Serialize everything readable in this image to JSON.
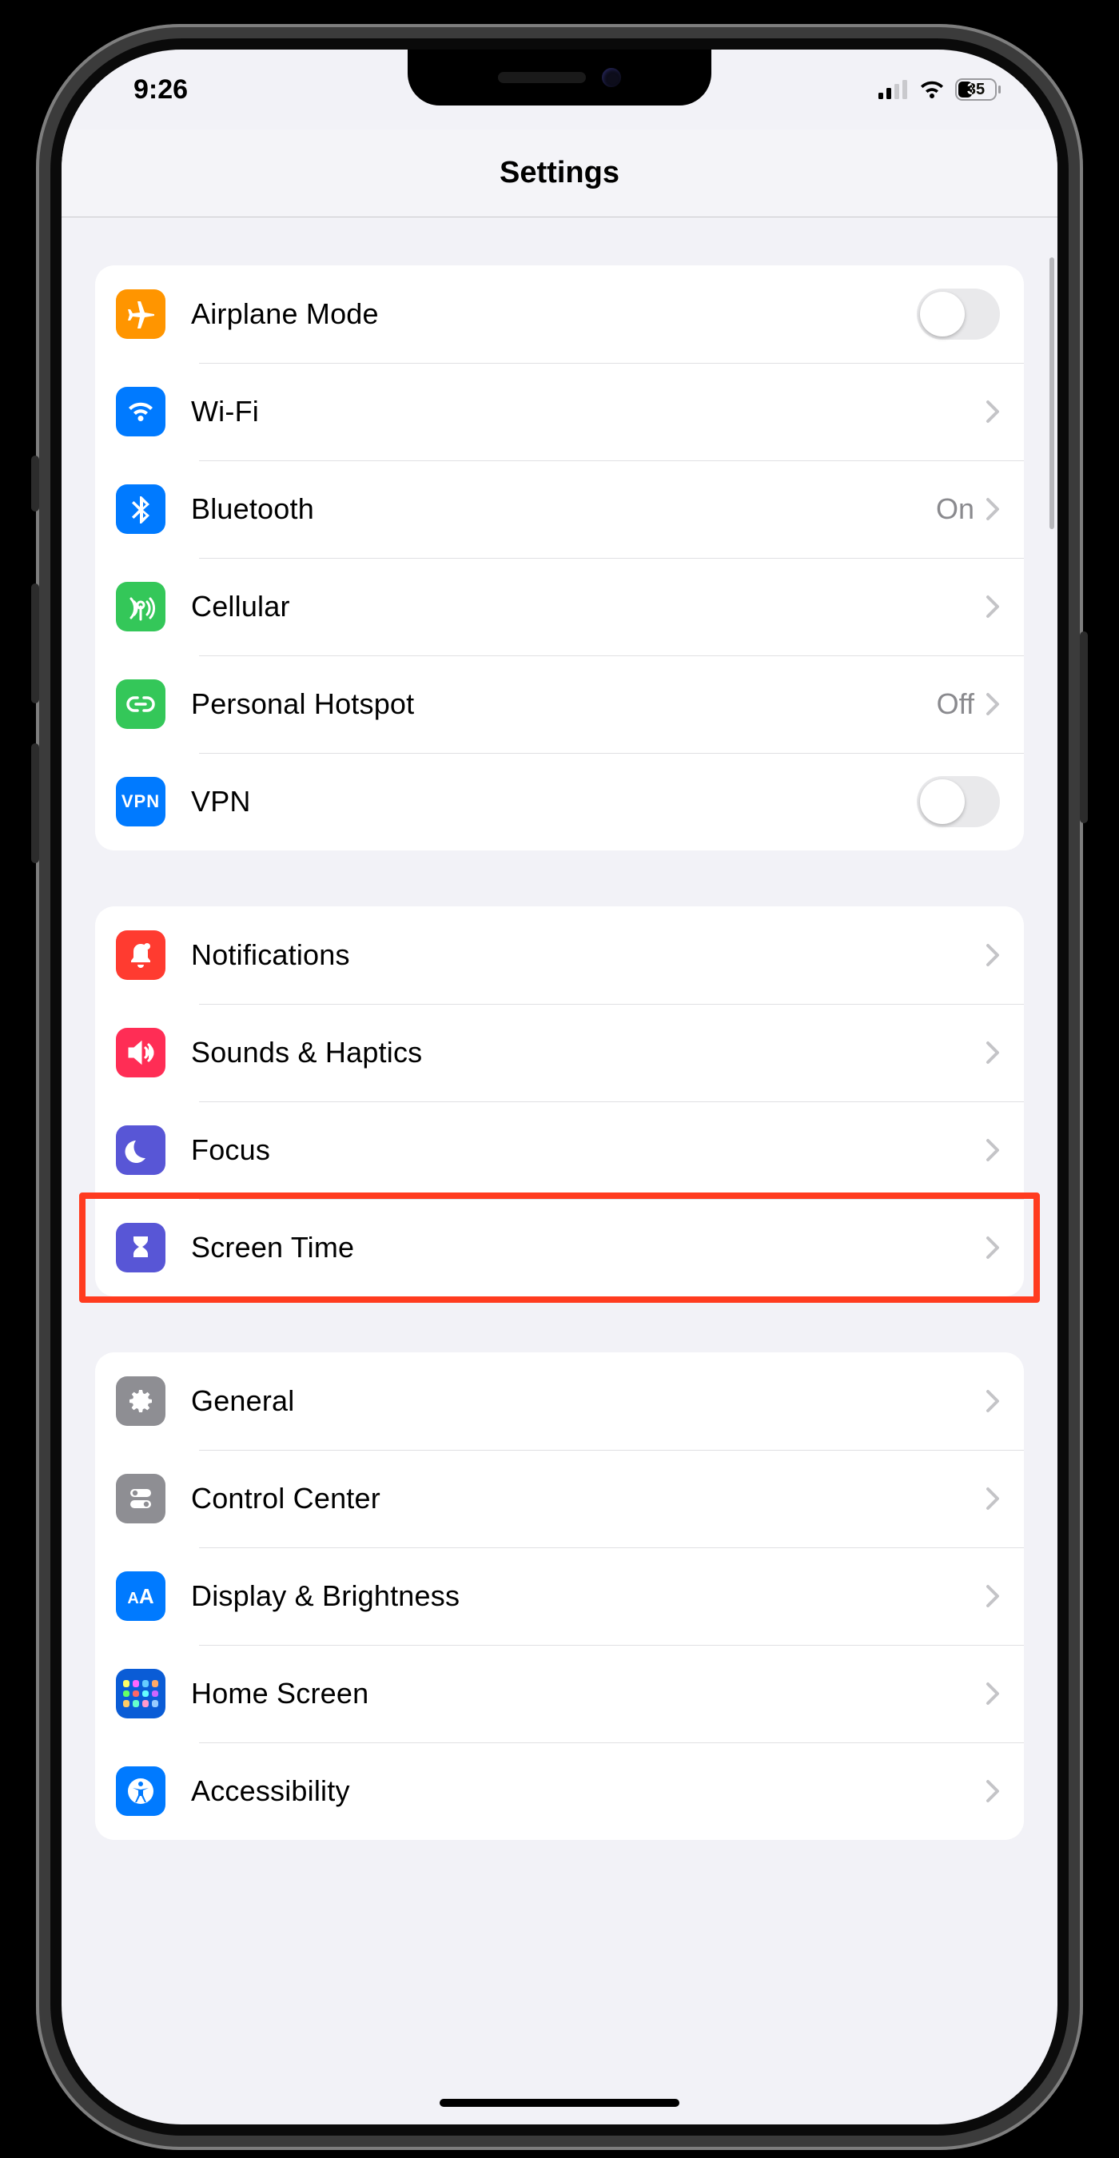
{
  "status": {
    "time": "9:26",
    "battery": "35"
  },
  "nav": {
    "title": "Settings"
  },
  "sections": [
    {
      "rows": [
        {
          "key": "airplane",
          "icon": "airplane-icon",
          "color": "c-orange",
          "label": "Airplane Mode",
          "control": "toggle",
          "toggled": false
        },
        {
          "key": "wifi",
          "icon": "wifi-icon",
          "color": "c-blue",
          "label": "Wi-Fi",
          "value": "",
          "chevron": true
        },
        {
          "key": "bluetooth",
          "icon": "bluetooth-icon",
          "color": "c-blue",
          "label": "Bluetooth",
          "value": "On",
          "chevron": true
        },
        {
          "key": "cellular",
          "icon": "antenna-icon",
          "color": "c-green",
          "label": "Cellular",
          "value": "",
          "chevron": true
        },
        {
          "key": "hotspot",
          "icon": "link-icon",
          "color": "c-green",
          "label": "Personal Hotspot",
          "value": "Off",
          "chevron": true
        },
        {
          "key": "vpn",
          "icon": "vpn-icon",
          "color": "c-blue",
          "label": "VPN",
          "control": "toggle",
          "toggled": false
        }
      ]
    },
    {
      "rows": [
        {
          "key": "notifications",
          "icon": "bell-icon",
          "color": "c-red",
          "label": "Notifications",
          "chevron": true
        },
        {
          "key": "sounds",
          "icon": "speaker-icon",
          "color": "c-pink",
          "label": "Sounds & Haptics",
          "chevron": true
        },
        {
          "key": "focus",
          "icon": "moon-icon",
          "color": "c-indigo",
          "label": "Focus",
          "chevron": true
        },
        {
          "key": "screentime",
          "icon": "hourglass-icon",
          "color": "c-indigo",
          "label": "Screen Time",
          "chevron": true,
          "highlighted": true
        }
      ]
    },
    {
      "rows": [
        {
          "key": "general",
          "icon": "gear-icon",
          "color": "c-gray",
          "label": "General",
          "chevron": true
        },
        {
          "key": "controlcenter",
          "icon": "toggles-icon",
          "color": "c-gray",
          "label": "Control Center",
          "chevron": true
        },
        {
          "key": "display",
          "icon": "textsize-icon",
          "color": "c-blue",
          "label": "Display & Brightness",
          "chevron": true
        },
        {
          "key": "homescreen",
          "icon": "grid-icon",
          "color": "c-darkblue",
          "label": "Home Screen",
          "chevron": true
        },
        {
          "key": "accessibility",
          "icon": "accessibility-icon",
          "color": "c-blue",
          "label": "Accessibility",
          "chevron": true
        }
      ]
    }
  ]
}
